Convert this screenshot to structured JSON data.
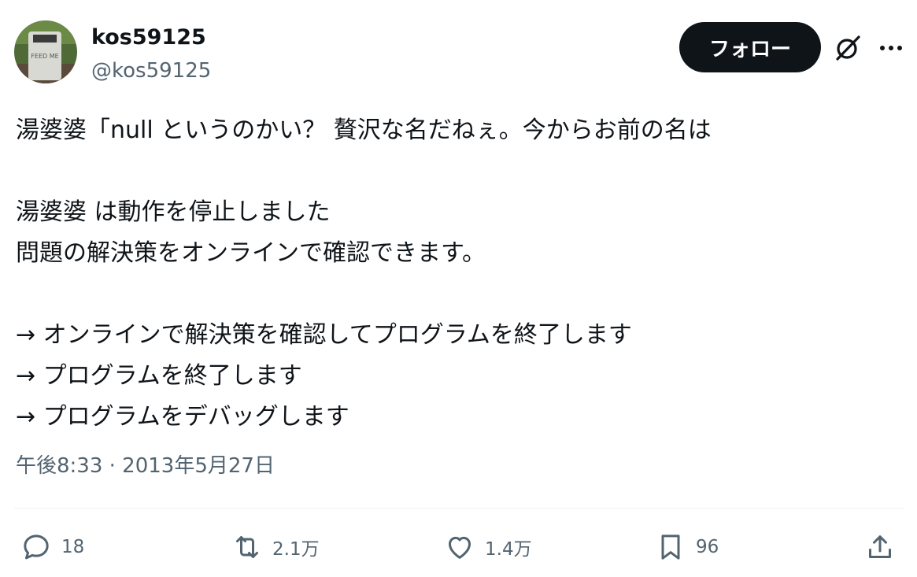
{
  "author": {
    "display_name": "kos59125",
    "handle": "@kos59125",
    "avatar_sign_text": "FEED ME"
  },
  "follow_button": {
    "label": "フォロー"
  },
  "tweet": {
    "lines": [
      "湯婆婆「null というのかい？ 贅沢な名だねぇ。今からお前の名は",
      "",
      "湯婆婆 は動作を停止しました",
      "問題の解決策をオンラインで確認できます。",
      "",
      "→ オンラインで解決策を確認してプログラムを終了します",
      "→ プログラムを終了します",
      "→ プログラムをデバッグします"
    ],
    "timestamp": "午後8:33 · 2013年5月27日"
  },
  "actions": {
    "reply_count": "18",
    "retweet_count": "2.1万",
    "like_count": "1.4万",
    "bookmark_count": "96"
  },
  "colors": {
    "text": "#0f1419",
    "secondary": "#536471",
    "follow_bg": "#0f1419",
    "divider": "#eff3f4"
  },
  "icons": [
    "grok-icon",
    "more-icon",
    "reply-icon",
    "retweet-icon",
    "like-icon",
    "bookmark-icon",
    "share-icon"
  ]
}
